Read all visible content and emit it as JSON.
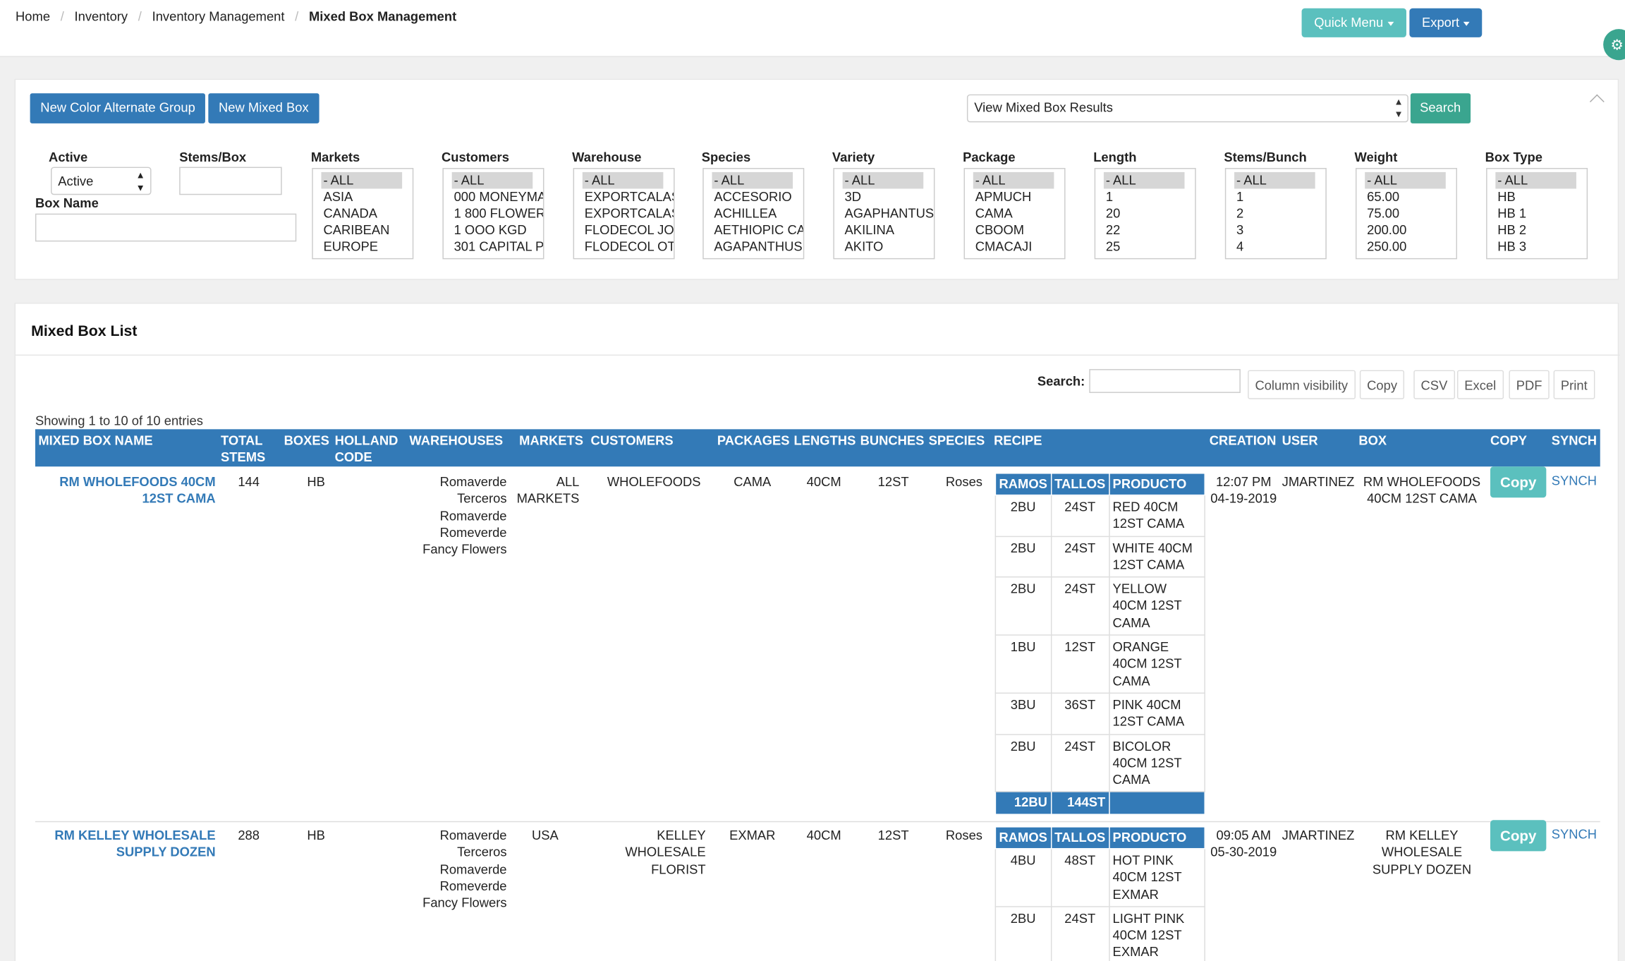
{
  "breadcrumb": [
    "Home",
    "Inventory",
    "Inventory Management",
    "Mixed Box Management"
  ],
  "topbar": {
    "quick_menu": "Quick Menu",
    "export": "Export"
  },
  "toolbar": {
    "new_color_group": "New Color Alternate Group",
    "new_mixed_box": "New Mixed Box",
    "view_select": "View Mixed Box Results",
    "search": "Search"
  },
  "filters": {
    "active_label": "Active",
    "active_value": "Active",
    "stems_box_label": "Stems/Box",
    "box_name_label": "Box Name",
    "lists": [
      {
        "label": "Markets",
        "options": [
          "- ALL",
          "ASIA",
          "CANADA",
          "CARIBEAN",
          "EUROPE"
        ]
      },
      {
        "label": "Customers",
        "options": [
          "- ALL",
          "000 MONEYMA",
          "1 800 FLOWER",
          "1 OOO KGD",
          "301 CAPITAL P/"
        ]
      },
      {
        "label": "Warehouse",
        "options": [
          "- ALL",
          "EXPORTCALAS",
          "EXPORTCALAS",
          "FLODECOL JO:",
          "FLODECOL OT("
        ]
      },
      {
        "label": "Species",
        "options": [
          "- ALL",
          "ACCESORIO",
          "ACHILLEA",
          "AETHIOPIC CA",
          "AGAPANTHUS"
        ]
      },
      {
        "label": "Variety",
        "options": [
          "- ALL",
          "3D",
          "AGAPHANTUS",
          "AKILINA",
          "AKITO"
        ]
      },
      {
        "label": "Package",
        "options": [
          "- ALL",
          "APMUCH",
          "CAMA",
          "CBOOM",
          "CMACAJI"
        ]
      },
      {
        "label": "Length",
        "options": [
          "- ALL",
          "1",
          "20",
          "22",
          "25"
        ]
      },
      {
        "label": "Stems/Bunch",
        "options": [
          "- ALL",
          "1",
          "2",
          "3",
          "4"
        ]
      },
      {
        "label": "Weight",
        "options": [
          "- ALL",
          "65.00",
          "75.00",
          "200.00",
          "250.00"
        ]
      },
      {
        "label": "Box Type",
        "options": [
          "- ALL",
          "HB",
          "HB 1",
          "HB 2",
          "HB 3"
        ]
      }
    ]
  },
  "list": {
    "title": "Mixed Box List",
    "search_label": "Search:",
    "buttons": [
      "Column visibility",
      "Copy",
      "CSV",
      "Excel",
      "PDF",
      "Print"
    ],
    "showing": "Showing 1 to 10 of 10 entries",
    "headers": {
      "name": "MIXED BOX NAME",
      "stems": "TOTAL STEMS",
      "boxes": "BOXES",
      "holland": "HOLLAND CODE",
      "warehouses": "WAREHOUSES",
      "markets": "MARKETS",
      "customers": "CUSTOMERS",
      "packages": "PACKAGES",
      "lengths": "LENGTHS",
      "bunches": "BUNCHES",
      "species": "SPECIES",
      "recipe": "RECIPE",
      "creation": "CREATION",
      "user": "USER",
      "box": "BOX",
      "copy": "COPY",
      "synch": "SYNCH"
    },
    "recipe_headers": [
      "RAMOS",
      "TALLOS",
      "PRODUCTO"
    ],
    "rows": [
      {
        "name": "RM WHOLEFOODS 40CM 12ST CAMA",
        "stems": "144",
        "boxes": "HB",
        "warehouses": [
          "Romaverde",
          "Terceros",
          "Romaverde",
          "Romeverde",
          "Fancy Flowers"
        ],
        "markets": "ALL MARKETS",
        "customers": "WHOLEFOODS",
        "packages": "CAMA",
        "lengths": "40CM",
        "bunches": "12ST",
        "species": "Roses",
        "recipe": [
          {
            "ramos": "2BU",
            "tallos": "24ST",
            "producto": "RED 40CM 12ST CAMA"
          },
          {
            "ramos": "2BU",
            "tallos": "24ST",
            "producto": "WHITE 40CM 12ST CAMA"
          },
          {
            "ramos": "2BU",
            "tallos": "24ST",
            "producto": "YELLOW 40CM 12ST CAMA"
          },
          {
            "ramos": "1BU",
            "tallos": "12ST",
            "producto": "ORANGE 40CM 12ST CAMA"
          },
          {
            "ramos": "3BU",
            "tallos": "36ST",
            "producto": "PINK 40CM 12ST CAMA"
          },
          {
            "ramos": "2BU",
            "tallos": "24ST",
            "producto": "BICOLOR 40CM 12ST CAMA"
          }
        ],
        "total_ramos": "12BU",
        "total_tallos": "144ST",
        "creation": "12:07 PM 04-19-2019",
        "user": "JMARTINEZ",
        "box": "RM WHOLEFOODS 40CM 12ST CAMA",
        "copy": "Copy",
        "synch": "SYNCH"
      },
      {
        "name": "RM KELLEY WHOLESALE SUPPLY DOZEN",
        "stems": "288",
        "boxes": "HB",
        "warehouses": [
          "Romaverde",
          "Terceros",
          "Romaverde",
          "Romeverde",
          "Fancy Flowers"
        ],
        "markets": "USA",
        "customers": "KELLEY WHOLESALE FLORIST",
        "packages": "EXMAR",
        "lengths": "40CM",
        "bunches": "12ST",
        "species": "Roses",
        "recipe": [
          {
            "ramos": "4BU",
            "tallos": "48ST",
            "producto": "HOT PINK 40CM 12ST EXMAR"
          },
          {
            "ramos": "2BU",
            "tallos": "24ST",
            "producto": "LIGHT PINK 40CM 12ST EXMAR"
          }
        ],
        "creation": "09:05 AM 05-30-2019",
        "user": "JMARTINEZ",
        "box": "RM KELLEY WHOLESALE SUPPLY DOZEN",
        "copy": "Copy",
        "synch": "SYNCH"
      }
    ]
  }
}
